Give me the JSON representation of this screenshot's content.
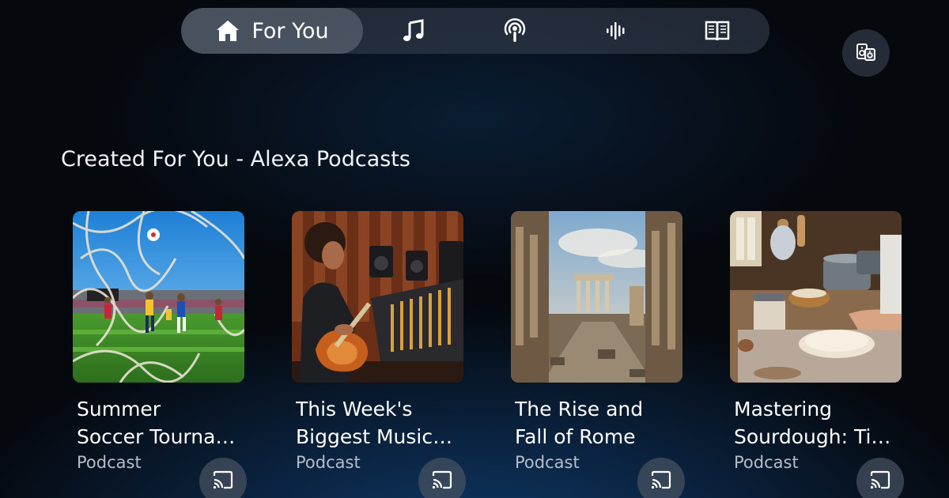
{
  "nav": {
    "items": [
      {
        "label": "For You",
        "icon": "home-icon",
        "active": true
      },
      {
        "label": "",
        "icon": "music-note-icon",
        "active": false
      },
      {
        "label": "",
        "icon": "podcast-icon",
        "active": false
      },
      {
        "label": "",
        "icon": "audio-waveform-icon",
        "active": false
      },
      {
        "label": "",
        "icon": "book-icon",
        "active": false
      }
    ]
  },
  "profile": {
    "icon": "speaker-group-icon"
  },
  "section": {
    "title": "Created For You - Alexa Podcasts"
  },
  "cards": [
    {
      "title_line1": "Summer",
      "title_line2": "Soccer Tourna…",
      "subtitle": "Podcast",
      "image": "soccer-goal-image",
      "cast_icon": "cast-icon"
    },
    {
      "title_line1": "This Week's",
      "title_line2": "Biggest Music…",
      "subtitle": "Podcast",
      "image": "music-studio-image",
      "cast_icon": "cast-icon"
    },
    {
      "title_line1": "The Rise and",
      "title_line2": "Fall of Rome",
      "subtitle": "Podcast",
      "image": "roman-ruins-image",
      "cast_icon": "cast-icon"
    },
    {
      "title_line1": "Mastering",
      "title_line2": "Sourdough: Ti…",
      "subtitle": "Podcast",
      "image": "bread-baking-image",
      "cast_icon": "cast-icon"
    }
  ],
  "colors": {
    "background": "#05080d",
    "nav_bg": "#3a4454",
    "subtitle": "#b7bdc7",
    "accent_glow": "#0f3a6a"
  }
}
